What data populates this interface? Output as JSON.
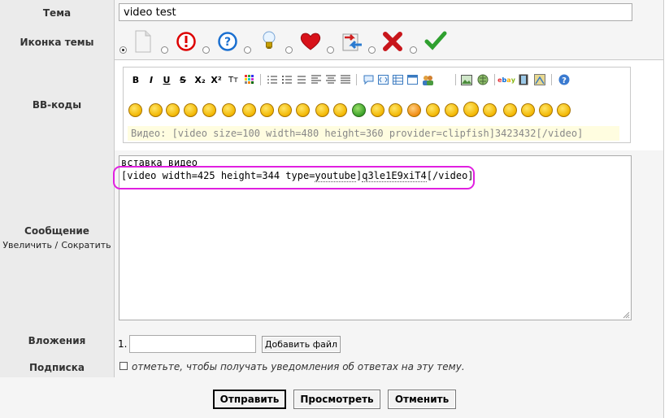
{
  "topic": {
    "label": "Тема",
    "value": "video test"
  },
  "icon_row": {
    "label": "Иконка темы",
    "icons": [
      "page-icon",
      "exclamation-icon",
      "question-icon",
      "lightbulb-icon",
      "heart-icon",
      "arrows-icon",
      "red-x-icon",
      "checkmark-icon"
    ]
  },
  "bbcodes": {
    "label": "BB-коды",
    "format_buttons": [
      "B",
      "I",
      "U",
      "S",
      "X₂",
      "X²",
      "Tт"
    ],
    "hint": "Видео: [video size=100 width=480 height=360 provider=clipfish]3423432[/video]"
  },
  "message": {
    "label": "Сообщение",
    "enlarge": "Увеличить /",
    "shrink": "Сократить",
    "line1": "вставка видео",
    "line2_pre": "[video width=425 height=344 type=",
    "line2_link1": "youtube",
    "line2_mid": "]",
    "line2_link2": "q3le1E9xiT4",
    "line2_post": "[/video]"
  },
  "attachments": {
    "label": "Вложения",
    "index": "1.",
    "add_button": "Добавить файл"
  },
  "subscribe": {
    "label": "Подписка",
    "text": "отметьте, чтобы получать уведомления об ответах на эту тему."
  },
  "actions": {
    "submit": "Отправить",
    "preview": "Просмотреть",
    "cancel": "Отменить"
  },
  "colors": {
    "label_bg": "#ebebeb",
    "value_bg": "#f5f5f5",
    "highlight": "#e020e0",
    "hint_bg": "#fffde0"
  }
}
